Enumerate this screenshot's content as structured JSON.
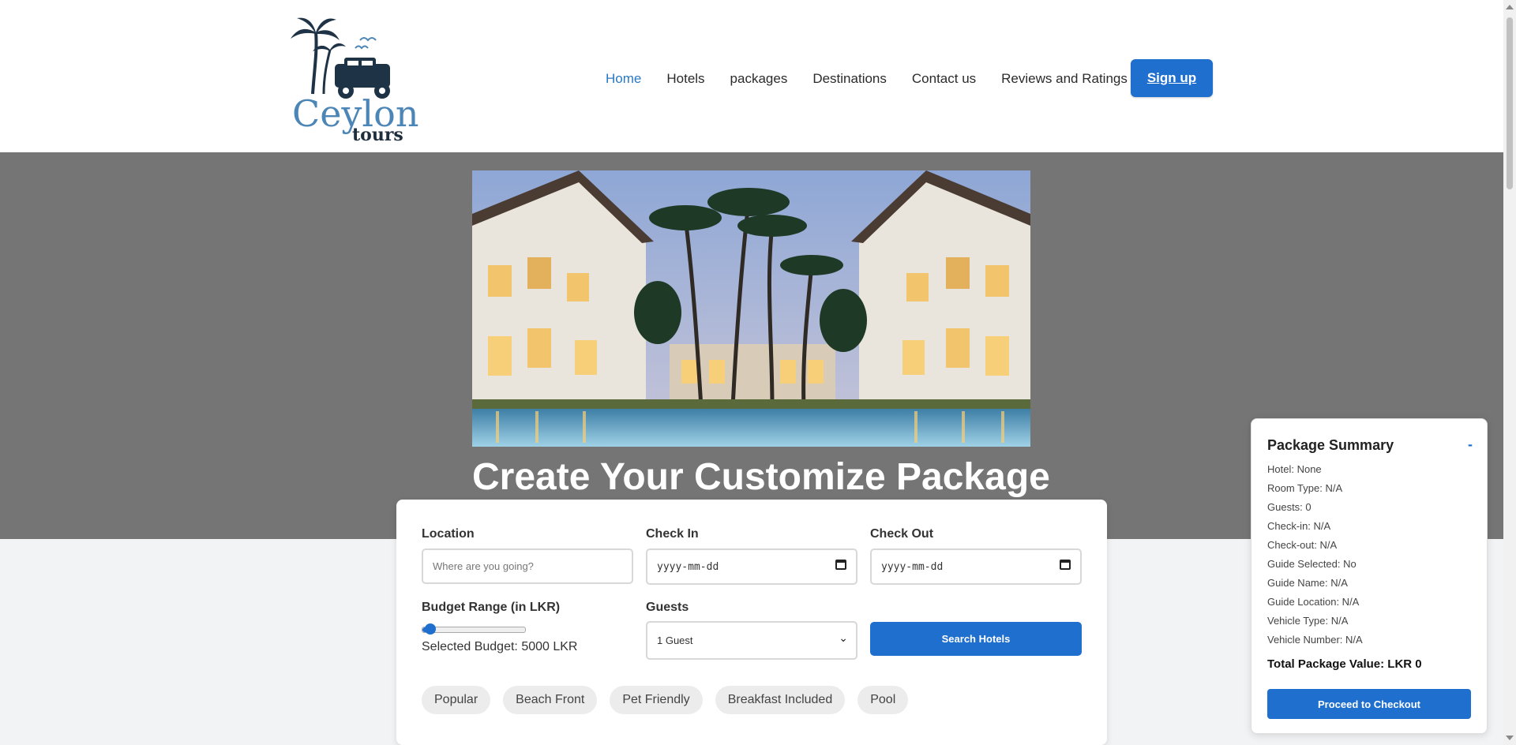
{
  "brand": {
    "line1": "Ceylon",
    "line2": "tours"
  },
  "nav": [
    {
      "label": "Home",
      "active": true
    },
    {
      "label": "Hotels"
    },
    {
      "label": "packages"
    },
    {
      "label": "Destinations"
    },
    {
      "label": "Contact us"
    },
    {
      "label": "Reviews and Ratings"
    }
  ],
  "signup_label": "Sign up",
  "hero": {
    "title": "Create Your Customize Package"
  },
  "search": {
    "location_label": "Location",
    "location_placeholder": "Where are you going?",
    "checkin_label": "Check In",
    "checkin_value": "yyyy-mm-dd",
    "checkout_label": "Check Out",
    "checkout_value": "yyyy-mm-dd",
    "budget_label": "Budget Range (in LKR)",
    "budget_fraction": 0.08,
    "selected_budget": "Selected Budget: 5000 LKR",
    "guests_label": "Guests",
    "guests_value": "1 Guest",
    "search_button": "Search Hotels"
  },
  "chips": [
    "Popular",
    "Beach Front",
    "Pet Friendly",
    "Breakfast Included",
    "Pool"
  ],
  "summary": {
    "title": "Package Summary",
    "collapse": "-",
    "rows": [
      "Hotel: None",
      "Room Type: N/A",
      "Guests: 0",
      "Check-in: N/A",
      "Check-out: N/A",
      "Guide Selected: No",
      "Guide Name: N/A",
      "Guide Location: N/A",
      "Vehicle Type: N/A",
      "Vehicle Number: N/A"
    ],
    "total": "Total Package Value: LKR 0",
    "checkout_button": "Proceed to Checkout"
  },
  "colors": {
    "accent": "#1f6fcf",
    "nav_active": "#2a78c2",
    "hero_bg": "#757575"
  }
}
